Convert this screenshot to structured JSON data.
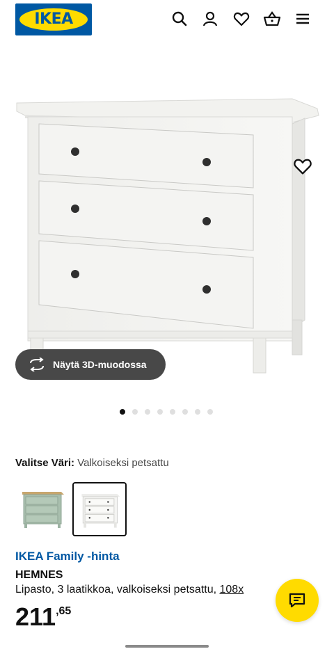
{
  "header": {
    "logo_text": "IKEA",
    "icons": [
      "search-icon",
      "profile-icon",
      "heart-icon",
      "basket-icon",
      "menu-icon"
    ]
  },
  "gallery": {
    "view_3d_label": "Näytä 3D-muodossa",
    "dot_count": 8,
    "active_dot": 0
  },
  "color": {
    "label": "Valitse Väri:",
    "value": "Valkoiseksi petsattu"
  },
  "swatches": [
    {
      "name": "green-variant",
      "selected": false
    },
    {
      "name": "white-stain-variant",
      "selected": true
    }
  ],
  "product": {
    "family_price_label": "IKEA Family -hinta",
    "name": "HEMNES",
    "description": "Lipasto, 3 laatikkoa, valkoiseksi petsattu, ",
    "size": "108x",
    "price_int": "211",
    "price_dec": ",65"
  },
  "colors": {
    "ikea_blue": "#0058a3",
    "ikea_yellow": "#ffdb00",
    "dark_button": "#484848"
  }
}
